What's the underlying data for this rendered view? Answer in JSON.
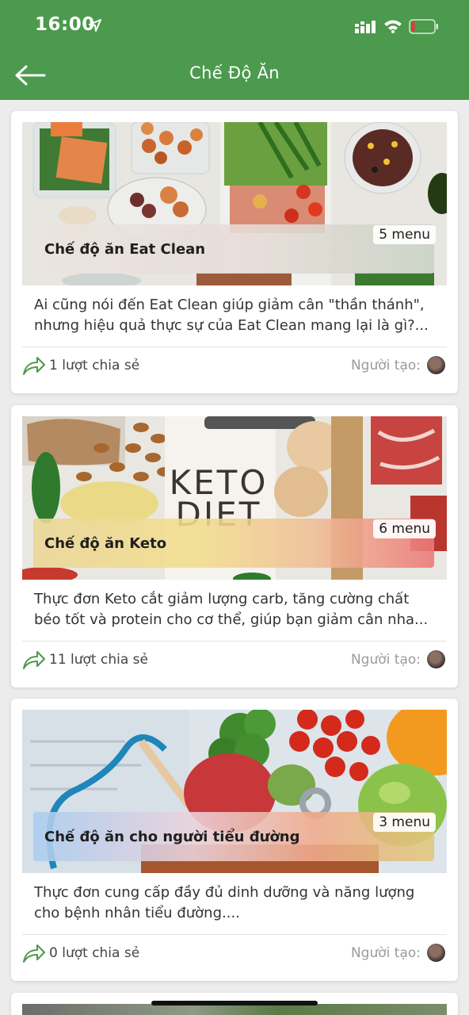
{
  "status_bar": {
    "time": "16:00"
  },
  "header": {
    "title": "Chế Độ Ăn"
  },
  "cards": [
    {
      "name": "Chế độ ăn Eat Clean",
      "menu_count": "5 menu",
      "description": "Ai cũng nói đến Eat Clean giúp giảm cân \"thần thánh\", nhưng hiệu quả thực sự của Eat Clean mang lại là gì?...",
      "shares": "1 lượt chia sẻ",
      "creator_label": "Người tạo:"
    },
    {
      "name": "Chế độ ăn Keto",
      "menu_count": "6 menu",
      "description": "Thực đơn Keto cắt giảm lượng carb, tăng cường chất béo tốt và protein cho cơ thể, giúp bạn giảm cân nha...",
      "shares": "11 lượt chia sẻ",
      "creator_label": "Người tạo:",
      "image_text": "KETO\nDIET"
    },
    {
      "name": "Chế độ ăn cho người tiểu đường",
      "menu_count": "3 menu",
      "description": "Thực đơn cung cấp đầy đủ dinh dưỡng và năng lượng cho bệnh nhân tiểu đường....",
      "shares": "0 lượt chia sẻ",
      "creator_label": "Người tạo:"
    }
  ],
  "colors": {
    "appbar": "#4b9a4d",
    "share_icon": "#4b9a4d",
    "battery_low": "#e53935"
  },
  "icons": [
    "location-arrow-icon",
    "signal-icon",
    "wifi-icon",
    "battery-icon",
    "back-arrow-icon",
    "share-icon",
    "avatar"
  ]
}
